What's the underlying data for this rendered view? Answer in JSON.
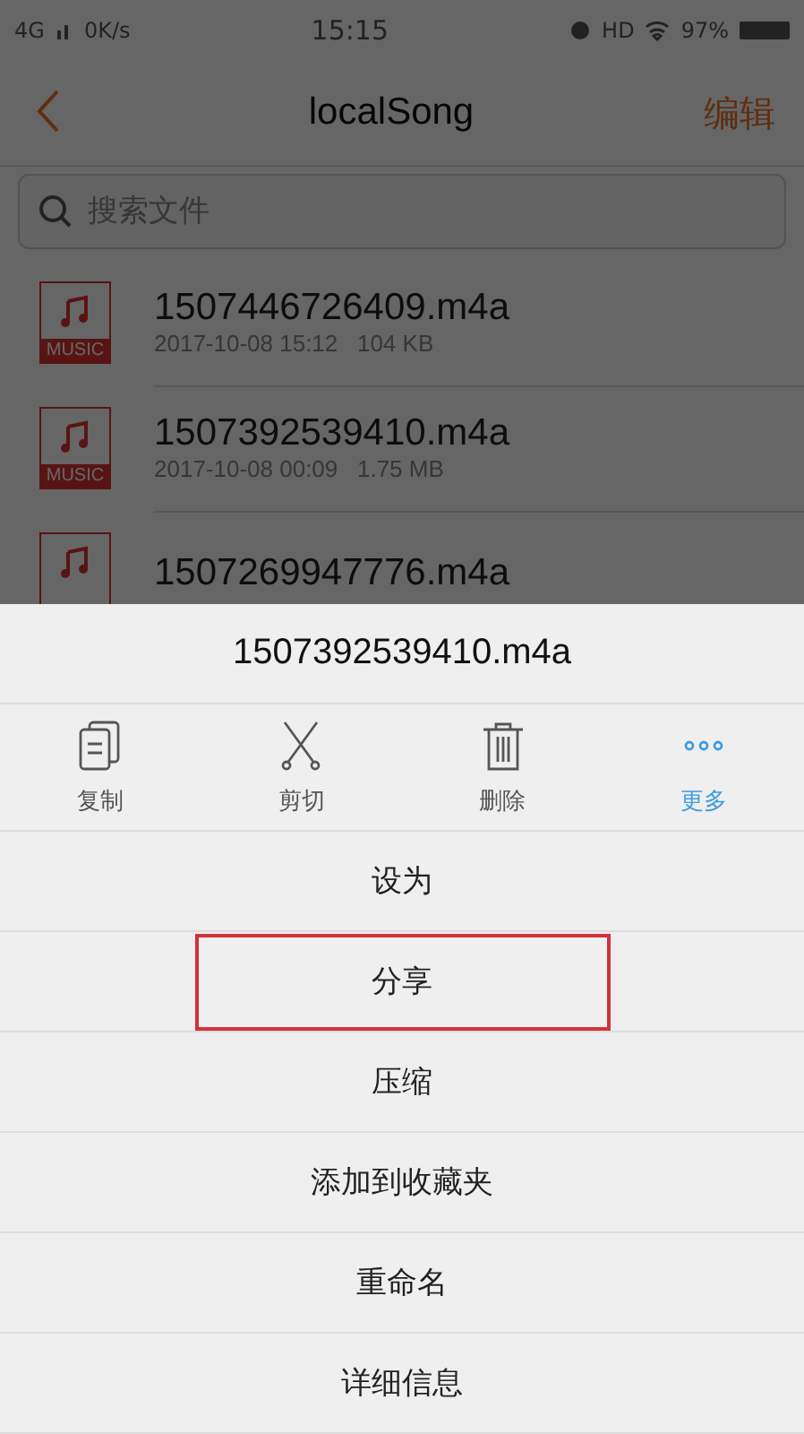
{
  "status_bar": {
    "network": "4G",
    "speed": "0K/s",
    "time": "15:15",
    "hd": "HD",
    "battery": "97%"
  },
  "nav": {
    "title": "localSong",
    "action": "编辑"
  },
  "search": {
    "placeholder": "搜索文件"
  },
  "files": [
    {
      "name": "1507446726409.m4a",
      "badge": "MUSIC",
      "meta": "2017-10-08 15:12   104 KB"
    },
    {
      "name": "1507392539410.m4a",
      "badge": "MUSIC",
      "meta": "2017-10-08 00:09   1.75 MB"
    },
    {
      "name": "1507269947776.m4a"
    }
  ],
  "sheet": {
    "title": "1507392539410.m4a",
    "actions": [
      {
        "kind": "copy",
        "label": "复制",
        "selected": false
      },
      {
        "kind": "cut",
        "label": "剪切",
        "selected": false
      },
      {
        "kind": "delete",
        "label": "删除",
        "selected": false
      },
      {
        "kind": "more",
        "label": "更多",
        "selected": true
      }
    ],
    "menu": [
      {
        "label": "设为",
        "highlighted": false
      },
      {
        "label": "分享",
        "highlighted": true
      },
      {
        "label": "压缩",
        "highlighted": false
      },
      {
        "label": "添加到收藏夹",
        "highlighted": false
      },
      {
        "label": "重命名",
        "highlighted": false
      },
      {
        "label": "详细信息",
        "highlighted": false
      }
    ]
  }
}
